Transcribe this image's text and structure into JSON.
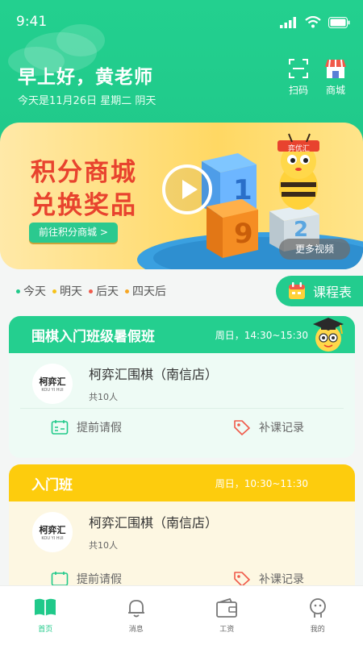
{
  "status": {
    "time": "9:41"
  },
  "header": {
    "greeting": "早上好，黄老师",
    "date": "今天是11月26日  星期二  阴天",
    "scan_label": "扫码",
    "shop_label": "商城"
  },
  "banner": {
    "title_line1": "积分商城",
    "title_line2": "兑换奖品",
    "cta": "前往积分商城 >",
    "more_video": "更多视频",
    "mascot_badge": "弈优汇",
    "cube_digits": [
      "1",
      "9",
      "2"
    ]
  },
  "days": [
    {
      "label": "今天",
      "color": "#20c98a"
    },
    {
      "label": "明天",
      "color": "#f6c21a"
    },
    {
      "label": "后天",
      "color": "#f05a4a"
    },
    {
      "label": "四天后",
      "color": "#f6a623"
    }
  ],
  "schedule_button": "课程表",
  "cards": [
    {
      "title": "围棋入门班级暑假班",
      "time": "周日，14:30~15:30",
      "head_color": "#24cf8f",
      "body_color": "#eefbf5",
      "org_logo": "柯弈汇",
      "org_logo_sub": "KOU YI HUI",
      "org_name": "柯弈汇围棋（南信店）",
      "count": "共10人",
      "leave": "提前请假",
      "makeup": "补课记录"
    },
    {
      "title": "入门班",
      "time": "周日，10:30~11:30",
      "head_color": "#fdcc0d",
      "body_color": "#fdf7e2",
      "org_logo": "柯弈汇",
      "org_logo_sub": "KOU YI HUI",
      "org_name": "柯弈汇围棋（南信店）",
      "count": "共10人",
      "leave": "提前请假",
      "makeup": "补课记录"
    }
  ],
  "tabs": [
    {
      "label": "首页",
      "icon": "book-icon",
      "active": true
    },
    {
      "label": "消息",
      "icon": "bell-icon",
      "active": false
    },
    {
      "label": "工资",
      "icon": "wallet-icon",
      "active": false
    },
    {
      "label": "我的",
      "icon": "profile-icon",
      "active": false
    }
  ],
  "colors": {
    "primary": "#20c98a",
    "banner_red": "#e8432e",
    "card2_head": "#fdcc0d"
  }
}
